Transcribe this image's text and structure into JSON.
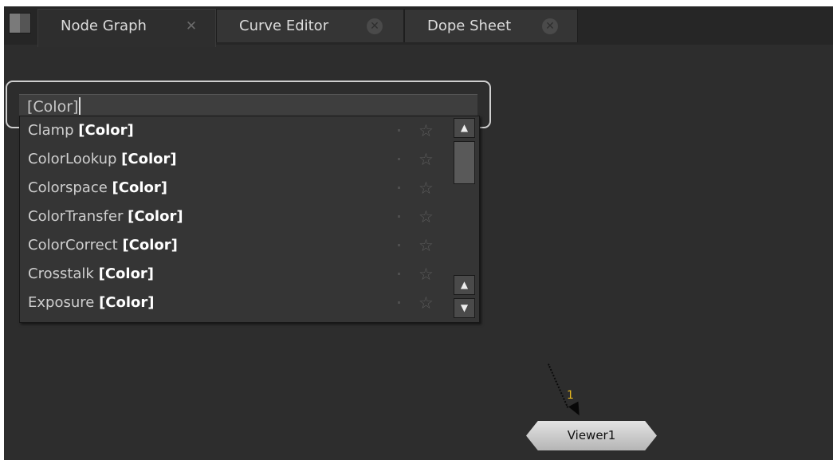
{
  "tabs": [
    {
      "label": "Node Graph",
      "close": "✕",
      "active": true
    },
    {
      "label": "Curve Editor",
      "close": "✕",
      "active": false
    },
    {
      "label": "Dope Sheet",
      "close": "✕",
      "active": false
    }
  ],
  "search": {
    "value": "[Color]"
  },
  "results": [
    {
      "name": "Clamp",
      "tag": "[Color]"
    },
    {
      "name": "ColorLookup",
      "tag": "[Color]"
    },
    {
      "name": "Colorspace",
      "tag": "[Color]"
    },
    {
      "name": "ColorTransfer",
      "tag": "[Color]"
    },
    {
      "name": "ColorCorrect",
      "tag": "[Color]"
    },
    {
      "name": "Crosstalk",
      "tag": "[Color]"
    },
    {
      "name": "Exposure",
      "tag": "[Color]"
    }
  ],
  "favorite_icon": "☆",
  "scrollbar": {
    "up_icon": "▲",
    "down_icon": "▼"
  },
  "node": {
    "label": "Viewer1",
    "input_number": "1"
  },
  "colors": {
    "background": "#2d2d2d",
    "tab_bar": "#262626",
    "input_number": "#e6b81e"
  }
}
